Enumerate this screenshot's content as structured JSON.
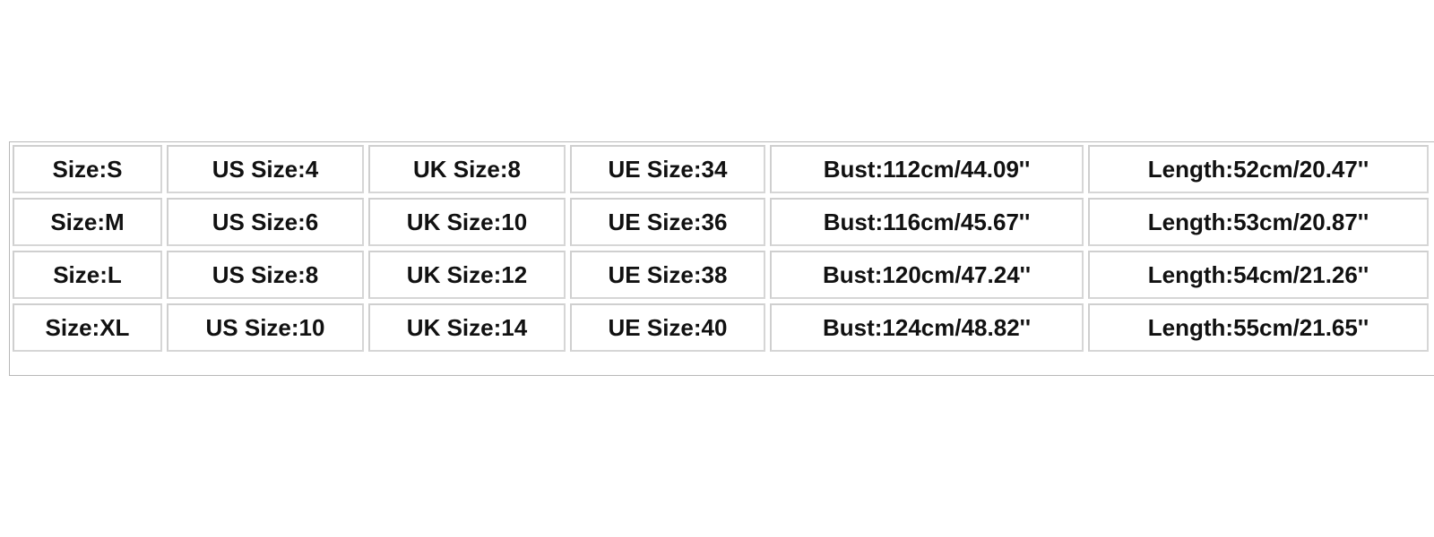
{
  "size_chart": {
    "rows": [
      {
        "size": "Size:S",
        "us": "US Size:4",
        "uk": "UK Size:8",
        "ue": "UE Size:34",
        "bust": "Bust:112cm/44.09''",
        "length": "Length:52cm/20.47''"
      },
      {
        "size": "Size:M",
        "us": "US Size:6",
        "uk": "UK Size:10",
        "ue": "UE Size:36",
        "bust": "Bust:116cm/45.67''",
        "length": "Length:53cm/20.87''"
      },
      {
        "size": "Size:L",
        "us": "US Size:8",
        "uk": "UK Size:12",
        "ue": "UE Size:38",
        "bust": "Bust:120cm/47.24''",
        "length": "Length:54cm/21.26''"
      },
      {
        "size": "Size:XL",
        "us": "US Size:10",
        "uk": "UK Size:14",
        "ue": "UE Size:40",
        "bust": "Bust:124cm/48.82''",
        "length": "Length:55cm/21.65''"
      }
    ]
  }
}
